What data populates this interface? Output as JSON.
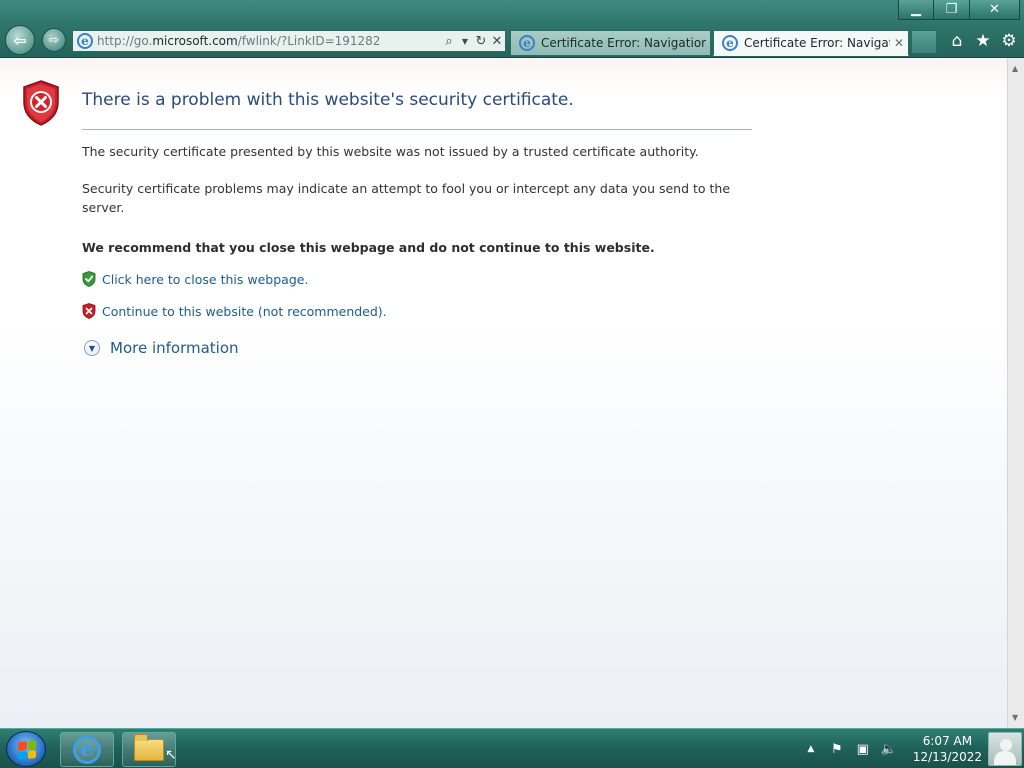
{
  "window": {
    "minimize_glyph": "▁",
    "restore_glyph": "❐",
    "close_glyph": "✕"
  },
  "address_bar": {
    "url_prefix": "http://go.",
    "url_domain": "microsoft.com",
    "url_suffix": "/fwlink/?LinkID=191282",
    "icons": [
      "search-icon",
      "dropdown-icon",
      "refresh-icon",
      "stop-icon"
    ]
  },
  "tabs": [
    {
      "label": "Certificate Error: Navigation Bl...",
      "active": false
    },
    {
      "label": "Certificate Error: Navigation...",
      "active": true,
      "close": "✕"
    }
  ],
  "toolbar_icons": [
    "home-icon",
    "favorites-icon",
    "tools-icon"
  ],
  "page": {
    "heading": "There is a problem with this website's security certificate.",
    "para1": "The security certificate presented by this website was not issued by a trusted certificate authority.",
    "para2": "Security certificate problems may indicate an attempt to fool you or intercept any data you send to the server.",
    "recommendation": "We recommend that you close this webpage and do not continue to this website.",
    "close_link": "Click here to close this webpage.",
    "continue_link": "Continue to this website (not recommended).",
    "more_info": "More information"
  },
  "taskbar": {
    "time": "6:07 AM",
    "date": "12/13/2022",
    "tray_icons": [
      "show-hidden-icons-arrow",
      "action-center-flag-icon",
      "network-icon",
      "volume-muted-icon"
    ]
  },
  "colors": {
    "chrome_teal": "#2f7469",
    "heading_blue": "#2a4a7a",
    "link_blue": "#1c5c91",
    "shield_red": "#c8202a",
    "shield_green": "#3a9a3a"
  }
}
